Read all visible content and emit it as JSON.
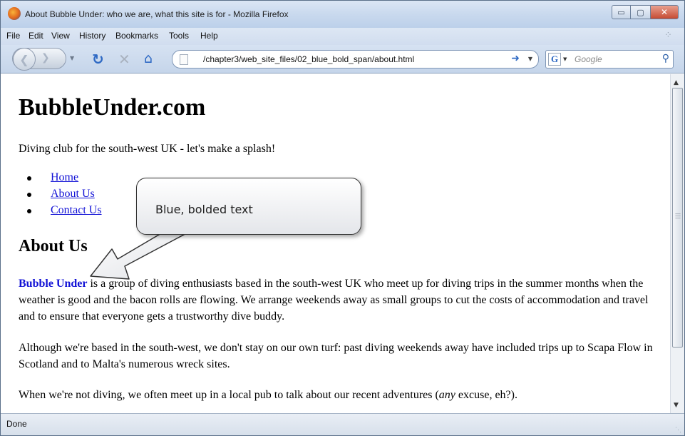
{
  "window": {
    "title": "About Bubble Under: who we are, what this site is for - Mozilla Firefox",
    "minimize_glyph": "▭",
    "maximize_glyph": "▢",
    "close_glyph": "✕"
  },
  "menu": {
    "items": [
      "File",
      "Edit",
      "View",
      "History",
      "Bookmarks",
      "Tools",
      "Help"
    ]
  },
  "navigation": {
    "url": "/chapter3/web_site_files/02_blue_bold_span/about.html",
    "search_placeholder": "Google",
    "search_engine_glyph": "G",
    "icons": {
      "back": "back-arrow-icon",
      "forward": "forward-arrow-icon",
      "reload": "reload-icon",
      "stop": "stop-icon",
      "home": "home-icon",
      "go": "go-arrow-icon",
      "search": "magnifier-icon"
    }
  },
  "page": {
    "site_title": "BubbleUnder.com",
    "tagline": "Diving club for the south-west UK - let's make a splash!",
    "nav_links": [
      "Home",
      "About Us",
      "Contact Us"
    ],
    "section_heading": "About Us",
    "paragraph1": {
      "highlight": "Bubble Under",
      "rest": " is a group of diving enthusiasts based in the south-west UK who meet up for diving trips in the summer months when the weather is good and the bacon rolls are flowing. We arrange weekends away as small groups to cut the costs of accommodation and travel and to ensure that everyone gets a trustworthy dive buddy."
    },
    "paragraph2": "Although we're based in the south-west, we don't stay on our own turf: past diving weekends away have included trips up to Scapa Flow in Scotland and to Malta's numerous wreck sites.",
    "paragraph3": {
      "before": "When we're not diving, we often meet up in a local pub to talk about our recent adventures (",
      "emphasis": "any",
      "after": " excuse, eh?)."
    }
  },
  "callout": {
    "text": "Blue, bolded text"
  },
  "status": {
    "text": "Done"
  },
  "colors": {
    "link": "#1212d6",
    "highlight": "#1212d6",
    "chrome": "#c9d9ee"
  }
}
